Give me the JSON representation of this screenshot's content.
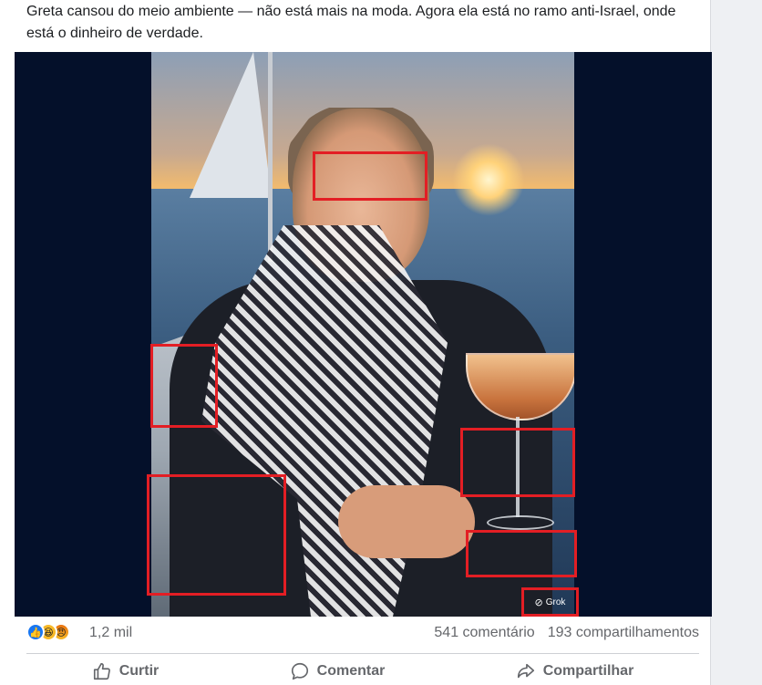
{
  "post": {
    "text": "Greta cansou do meio ambiente — não está mais na moda. Agora ela está no ramo anti-Israel, onde está o dinheiro de verdade."
  },
  "media": {
    "watermark": "Grok",
    "highlight_color": "#e31e24"
  },
  "reactions": {
    "icons": [
      "like-icon",
      "haha-icon",
      "angry-icon"
    ],
    "count": "1,2 mil"
  },
  "stats": {
    "comments": "541 comentário",
    "shares": "193 compartilhamentos"
  },
  "actions": {
    "like": "Curtir",
    "comment": "Comentar",
    "share": "Compartilhar"
  }
}
